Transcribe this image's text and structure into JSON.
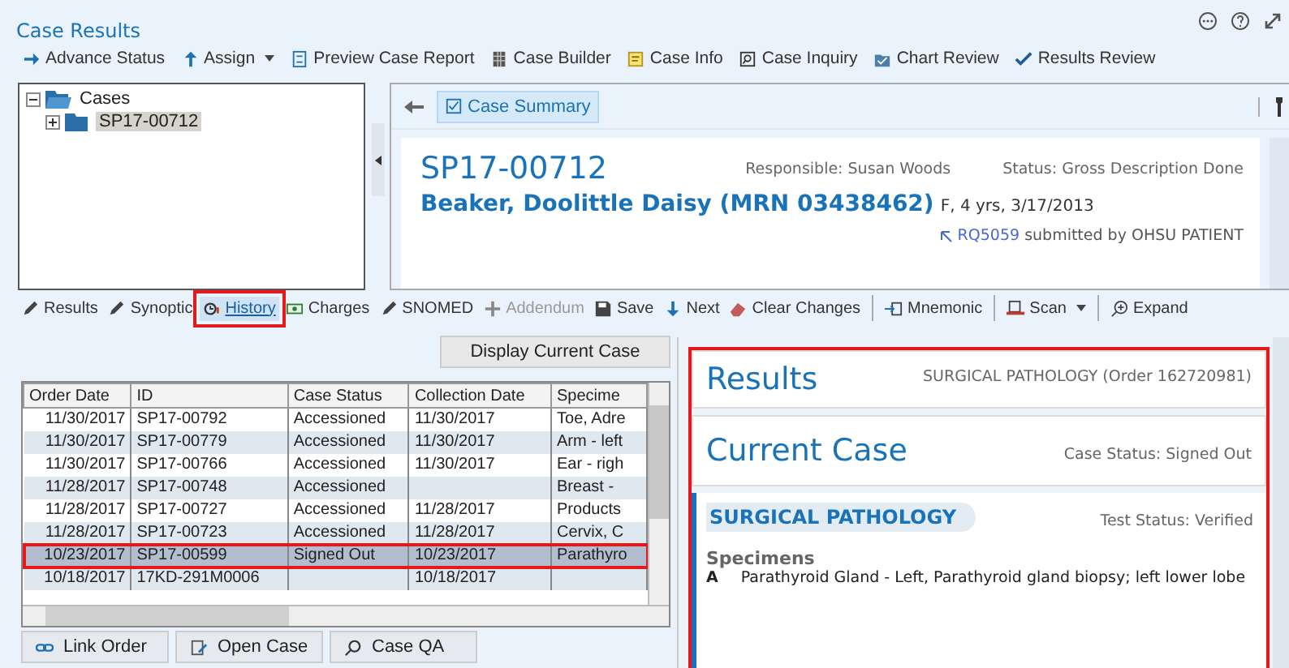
{
  "window": {
    "title": "Case Results"
  },
  "toolbar": [
    {
      "label": "Advance Status",
      "has_menu": false
    },
    {
      "label": "Assign",
      "has_menu": true
    },
    {
      "label": "Preview Case Report",
      "has_menu": false
    },
    {
      "label": "Case Builder",
      "has_menu": false
    },
    {
      "label": "Case Info",
      "has_menu": false
    },
    {
      "label": "Case Inquiry",
      "has_menu": false
    },
    {
      "label": "Chart Review",
      "has_menu": false
    },
    {
      "label": "Results Review",
      "has_menu": false
    }
  ],
  "tree": {
    "label": "Cases",
    "expanded": true,
    "children": [
      {
        "label": "SP17-00712",
        "expanded": false,
        "selected": true
      }
    ]
  },
  "summary_tabs": [
    {
      "label": "Case Summary",
      "selected": true
    }
  ],
  "case_card": {
    "case_id": "SP17-00712",
    "responsible": "Responsible: Susan Woods",
    "status": "Status: Gross Description Done",
    "patient_name": "Beaker, Doolittle Daisy (MRN 03438462)",
    "patient_details": "F, 4 yrs, 3/17/2013",
    "request_link": "RQ5059",
    "submitted": "submitted by OHSU PATIENT"
  },
  "activity_toolbar": [
    {
      "label": "Results",
      "selected": false,
      "disabled": false,
      "highlighted": false,
      "has_menu": false
    },
    {
      "label": "Synoptic",
      "selected": false,
      "disabled": false,
      "highlighted": false,
      "has_menu": false
    },
    {
      "label": "History",
      "selected": true,
      "disabled": false,
      "highlighted": true,
      "has_menu": false
    },
    {
      "label": "Charges",
      "selected": false,
      "disabled": false,
      "highlighted": false,
      "has_menu": false
    },
    {
      "label": "SNOMED",
      "selected": false,
      "disabled": false,
      "highlighted": false,
      "has_menu": false
    },
    {
      "label": "Addendum",
      "selected": false,
      "disabled": true,
      "highlighted": false,
      "has_menu": false
    },
    {
      "label": "Save",
      "selected": false,
      "disabled": false,
      "highlighted": false,
      "has_menu": false
    },
    {
      "label": "Next",
      "selected": false,
      "disabled": false,
      "highlighted": false,
      "has_menu": false
    },
    {
      "label": "Clear Changes",
      "selected": false,
      "disabled": false,
      "highlighted": false,
      "has_menu": false
    },
    {
      "label": "Mnemonic",
      "selected": false,
      "disabled": false,
      "has_menu": false
    },
    {
      "label": "Scan",
      "selected": false,
      "disabled": false,
      "has_menu": true
    },
    {
      "label": "Expand",
      "selected": false,
      "disabled": false,
      "has_menu": false
    }
  ],
  "display_current_button": "Display Current Case",
  "table": {
    "columns": [
      "Order Date",
      "ID",
      "Case Status",
      "Collection Date",
      "Specime"
    ],
    "rows": [
      {
        "order_date": "11/30/2017",
        "id": "SP17-00792",
        "case_status": "Accessioned",
        "collection_date": "11/30/2017",
        "specimen": "Toe, Adre",
        "selected": false,
        "highlighted": false
      },
      {
        "order_date": "11/30/2017",
        "id": "SP17-00779",
        "case_status": "Accessioned",
        "collection_date": "11/30/2017",
        "specimen": "Arm - left",
        "selected": false,
        "highlighted": false
      },
      {
        "order_date": "11/30/2017",
        "id": "SP17-00766",
        "case_status": "Accessioned",
        "collection_date": "11/30/2017",
        "specimen": "Ear - righ",
        "selected": false,
        "highlighted": false
      },
      {
        "order_date": "11/28/2017",
        "id": "SP17-00748",
        "case_status": "Accessioned",
        "specimen": "Breast -",
        "selected": false,
        "highlighted": false
      },
      {
        "order_date": "11/28/2017",
        "id": "SP17-00727",
        "case_status": "Accessioned",
        "collection_date": "11/28/2017",
        "specimen": "Products",
        "selected": false,
        "highlighted": false
      },
      {
        "order_date": "11/28/2017",
        "id": "SP17-00723",
        "case_status": "Accessioned",
        "collection_date": "11/28/2017",
        "specimen": "Cervix, C",
        "selected": false,
        "highlighted": false
      },
      {
        "order_date": "10/23/2017",
        "id": "SP17-00599",
        "case_status": "Signed Out",
        "collection_date": "10/23/2017",
        "specimen": "Parathyro",
        "selected": true,
        "highlighted": true
      },
      {
        "order_date": "10/18/2017",
        "id": "17KD-291M0006",
        "collection_date": "10/18/2017",
        "selected": false,
        "highlighted": false
      }
    ]
  },
  "bottom_buttons": [
    "Link Order",
    "Open Case",
    "Case QA"
  ],
  "results": {
    "highlighted": true,
    "title": "Results",
    "order": "SURGICAL PATHOLOGY (Order 162720981)",
    "current_title": "Current Case",
    "case_status": "Case Status: Signed Out",
    "section": "SURGICAL PATHOLOGY",
    "test_status": "Test Status: Verified",
    "specimens_heading": "Specimens",
    "specimens": [
      {
        "letter": "A",
        "text": "Parathyroid Gland - Left, Parathyroid gland biopsy; left lower lobe"
      }
    ]
  }
}
